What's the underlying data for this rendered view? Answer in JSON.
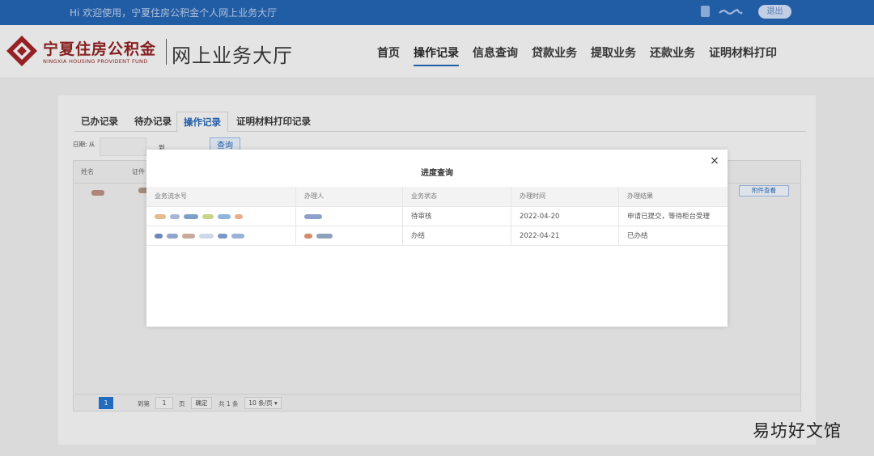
{
  "topbar": {
    "welcome": "Hi 欢迎使用，宁夏住房公积金个人网上业务大厅",
    "logout": "退出",
    "icons": [
      "document-icon",
      "signal-icon"
    ]
  },
  "header": {
    "brand_cn": "宁夏住房公积金",
    "brand_en": "NINGXIA HOUSING PROVIDENT FUND",
    "hall_title": "网上业务大厅",
    "nav": [
      "首页",
      "操作记录",
      "信息查询",
      "贷款业务",
      "提取业务",
      "还款业务",
      "证明材料打印"
    ],
    "nav_active": "操作记录"
  },
  "panel": {
    "tabs": [
      "已办记录",
      "待办记录",
      "操作记录",
      "证明材料打印记录"
    ],
    "active_tab": "操作记录",
    "filter": {
      "date_label": "日期: 从",
      "to_label": "到",
      "query": "查询"
    },
    "list_headers": [
      "姓名",
      "证件"
    ],
    "attach_button": "附件查看",
    "pager": {
      "current_page": "1",
      "goto_label": "到第",
      "goto_value": "1",
      "page_label": "页",
      "confirm": "确定",
      "total": "共 1 条",
      "page_size": "10 条/页 ▾"
    }
  },
  "modal": {
    "title": "进度查询",
    "close": "×",
    "columns": [
      "业务流水号",
      "办理人",
      "业务状态",
      "办理时间",
      "办理结果"
    ],
    "rows": [
      {
        "status": "待审核",
        "time": "2022-04-20",
        "result": "申请已提交，等待柜台受理"
      },
      {
        "status": "办结",
        "time": "2022-04-21",
        "result": "已办结"
      }
    ]
  },
  "watermark": "易坊好文馆",
  "colors": {
    "brand_blue": "#1f5fab",
    "brand_red": "#8b1d1d",
    "page_blue": "#1f6fc7"
  }
}
